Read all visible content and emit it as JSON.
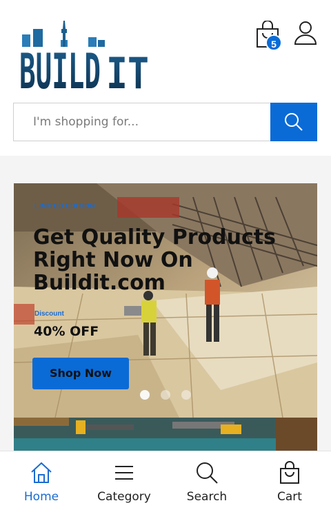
{
  "header": {
    "logo_text": "BUILD IT",
    "cart_count": "5"
  },
  "search": {
    "placeholder": "I'm shopping for..."
  },
  "banner": {
    "tag": "LIMITED EDITION",
    "headline": "Get Quality Products Right Now On Buildit.com",
    "discount_label": "Discount",
    "discount_value": "40% OFF",
    "button_label": "Shop Now",
    "slides": 3,
    "active_slide": 1
  },
  "bottom_nav": {
    "items": [
      {
        "label": "Home",
        "icon": "home-icon",
        "active": true
      },
      {
        "label": "Category",
        "icon": "menu-icon",
        "active": false
      },
      {
        "label": "Search",
        "icon": "search-icon",
        "active": false
      },
      {
        "label": "Cart",
        "icon": "bag-icon",
        "active": false
      }
    ]
  },
  "colors": {
    "accent": "#0a6bd6",
    "active_nav": "#1a6bd1"
  }
}
